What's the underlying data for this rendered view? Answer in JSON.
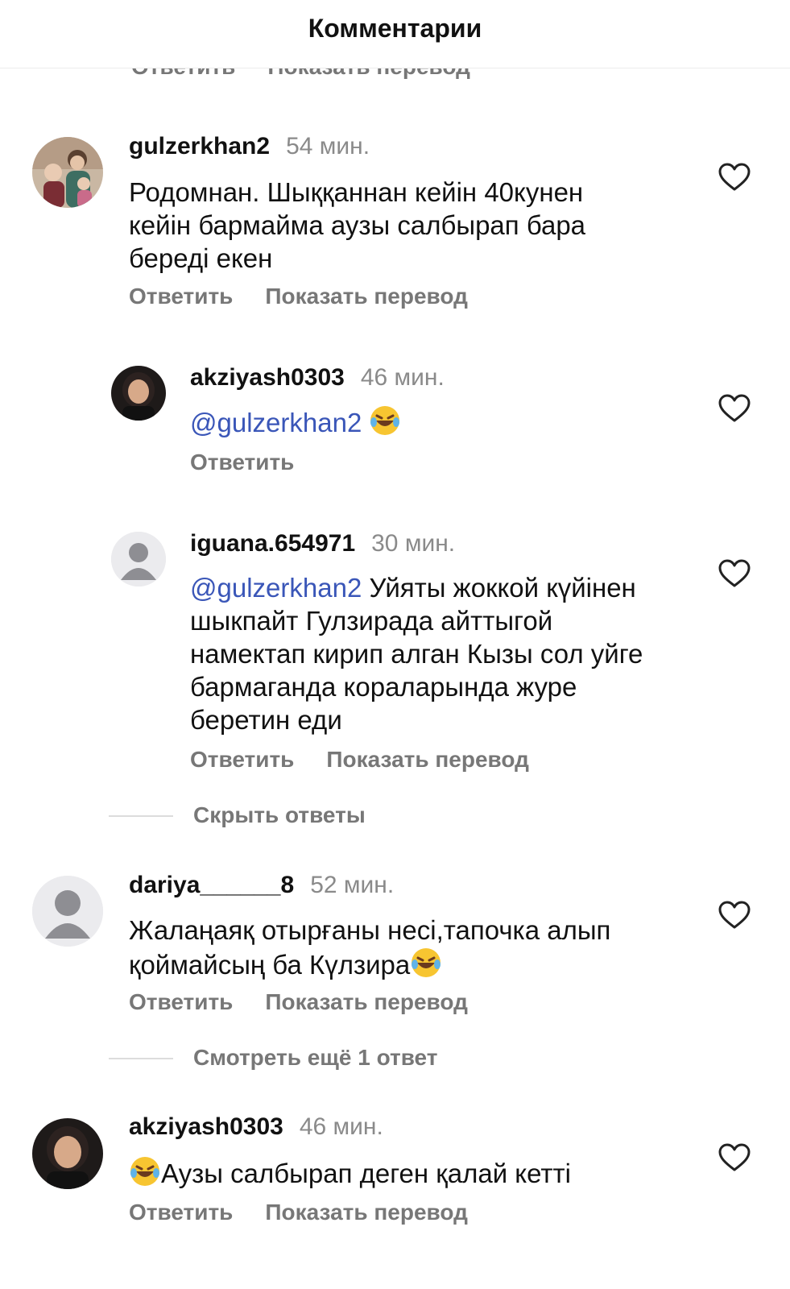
{
  "header": {
    "title": "Комментарии"
  },
  "partial_actions": {
    "reply": "Ответить",
    "translate": "Показать перевод"
  },
  "comments": [
    {
      "user": "gulzerkhan2",
      "time": "54 мин.",
      "text": "Родомнан. Шыққаннан кейін 40кунен кейін бармайма аузы салбырап  бара береді екен",
      "reply": "Ответить",
      "translate": "Показать перевод",
      "avatar": "photo-mother-children"
    },
    {
      "user": "akziyash0303",
      "time": "46 мин.",
      "mention": "@gulzerkhan2",
      "text": "",
      "emoji": "laughing-tears-emoji",
      "reply": "Ответить",
      "avatar": "photo-woman"
    },
    {
      "user": "iguana.654971",
      "time": "30 мин.",
      "mention": "@gulzerkhan2",
      "text": " Уйяты жоккой күйінен шыкпайт Гулзирада айттыгой намектап кирип алган Кызы сол уйге бармаганда кораларында журе беретин еди",
      "reply": "Ответить",
      "translate": "Показать перевод",
      "avatar": "default-person"
    },
    {
      "user": "dariya______8",
      "time": "52 мин.",
      "text": "Жалаңаяқ отырғаны несі,тапочка алып қоймайсың ба Күлзира",
      "emoji": "laughing-tears-emoji",
      "reply": "Ответить",
      "translate": "Показать перевод",
      "avatar": "default-person"
    },
    {
      "user": "akziyash0303",
      "time": "46 мин.",
      "text": "Аузы салбырап деген қалай кетті",
      "emoji": "laughing-tears-emoji",
      "reply": "Ответить",
      "translate": "Показать перевод",
      "avatar": "photo-woman"
    }
  ],
  "threads": {
    "hide_replies": "Скрыть ответы",
    "view_more": "Смотреть ещё 1 ответ"
  },
  "colors": {
    "mention": "#3a56b8",
    "secondary": "#777777",
    "like_outline": "#222222"
  }
}
